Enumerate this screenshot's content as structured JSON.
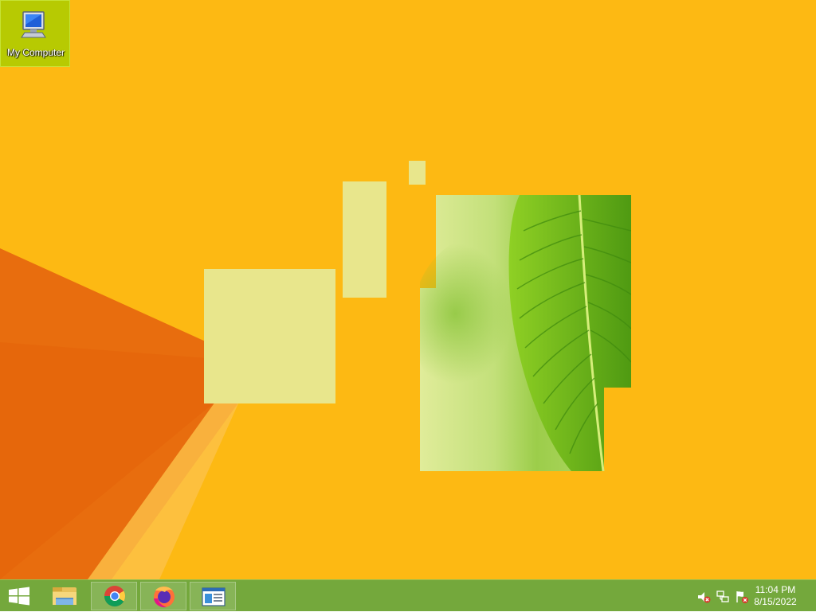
{
  "desktop": {
    "icons": [
      {
        "label": "My Computer",
        "icon": "computer-icon"
      }
    ],
    "background_color": "#fdb913"
  },
  "taskbar": {
    "color": "#74a83c",
    "start_icon": "windows-logo-icon",
    "apps": [
      {
        "name": "file-explorer",
        "icon": "folder-icon"
      },
      {
        "name": "chrome",
        "icon": "chrome-icon"
      },
      {
        "name": "firefox",
        "icon": "firefox-icon"
      },
      {
        "name": "window",
        "icon": "window-icon"
      }
    ],
    "tray": {
      "icons": [
        "volume-muted-icon",
        "network-icon",
        "action-center-flag-icon"
      ],
      "time": "11:04 PM",
      "date": "8/15/2022"
    }
  }
}
